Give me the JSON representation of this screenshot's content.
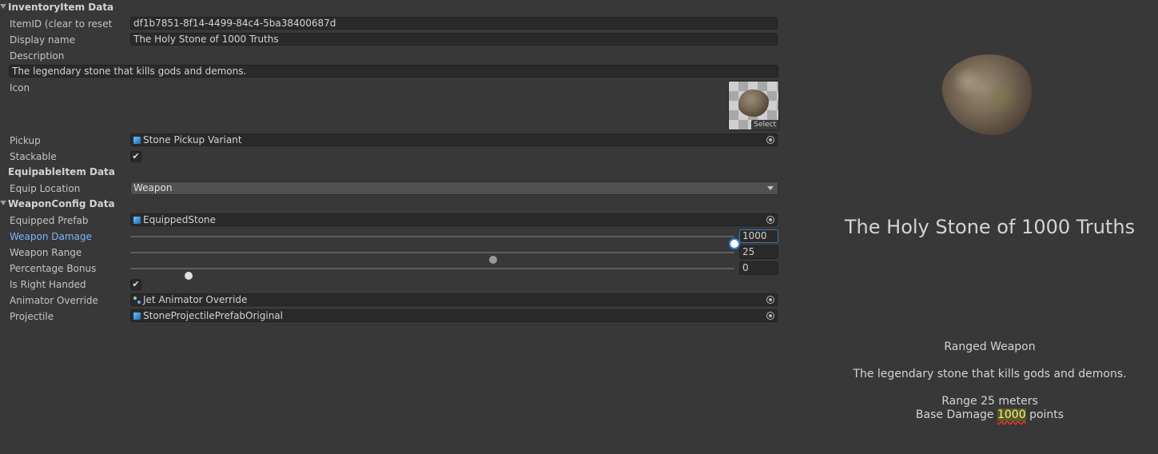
{
  "inspector": {
    "sections": {
      "inventory": "InventoryItem Data",
      "equipable": "EquipableItem Data",
      "weapon": "WeaponConfig Data"
    },
    "item_id": {
      "label": "ItemID (clear to reset",
      "value": "df1b7851-8f14-4499-84c4-5ba38400687d"
    },
    "display_name": {
      "label": "Display name",
      "value": "The Holy Stone of 1000 Truths"
    },
    "description": {
      "label": "Description",
      "value": "The legendary stone that kills gods and demons."
    },
    "icon": {
      "label": "Icon",
      "select_label": "Select",
      "icon_name": "rock-icon"
    },
    "pickup": {
      "label": "Pickup",
      "value": "Stone Pickup Variant",
      "icon_name": "prefab-cube-icon"
    },
    "stackable": {
      "label": "Stackable",
      "checked": true,
      "check_glyph": "✔"
    },
    "equip_location": {
      "label": "Equip Location",
      "value": "Weapon"
    },
    "equipped_prefab": {
      "label": "Equipped Prefab",
      "value": "EquippedStone",
      "icon_name": "prefab-cube-icon"
    },
    "weapon_damage": {
      "label": "Weapon Damage",
      "value": "1000",
      "slider_fraction": 1.0
    },
    "weapon_range": {
      "label": "Weapon Range",
      "value": "25",
      "slider_fraction": 0.6
    },
    "percentage_bonus": {
      "label": "Percentage Bonus",
      "value": "0",
      "slider_fraction": 0.097
    },
    "is_right_handed": {
      "label": "Is Right Handed",
      "checked": true,
      "check_glyph": "✔"
    },
    "animator_override": {
      "label": "Animator Override",
      "value": "Jet Animator Override",
      "icon_name": "animator-override-icon"
    },
    "projectile": {
      "label": "Projectile",
      "value": "StoneProjectilePrefabOriginal",
      "icon_name": "prefab-cube-icon"
    }
  },
  "preview": {
    "title": "The Holy Stone of 1000 Truths",
    "category": "Ranged Weapon",
    "description": "The legendary stone that kills gods and demons.",
    "range_prefix": "Range",
    "range_value": "25",
    "range_unit": "meters",
    "damage_prefix": "Base Damage",
    "damage_value": "1000",
    "damage_unit": "points"
  },
  "colors": {
    "background": "#383838",
    "field": "#2a2a2a",
    "active_label": "#7ab4ff",
    "focus": "#3a7cd8"
  }
}
